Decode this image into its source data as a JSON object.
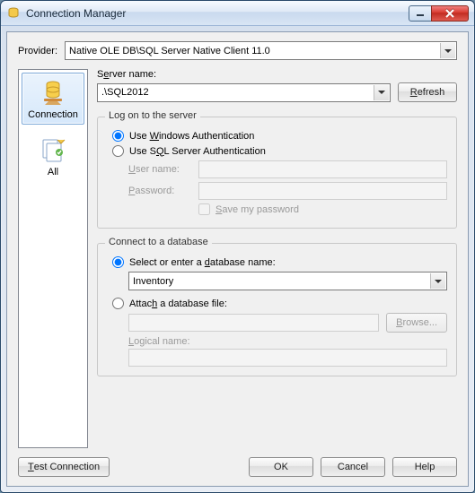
{
  "window": {
    "title": "Connection Manager"
  },
  "provider": {
    "label": "Provider:",
    "value": "Native OLE DB\\SQL Server Native Client 11.0"
  },
  "sidebar": {
    "items": [
      {
        "label": "Connection"
      },
      {
        "label": "All"
      }
    ]
  },
  "server": {
    "name_label": "Server name:",
    "value": ".\\SQL2012",
    "refresh_label": "Refresh"
  },
  "logon": {
    "legend": "Log on to the server",
    "use_windows_label": "Use Windows Authentication",
    "use_sql_label": "Use SQL Server Authentication",
    "username_label": "User name:",
    "username_value": "",
    "password_label": "Password:",
    "password_value": "",
    "save_password_label": "Save my password",
    "auth_mode": "windows",
    "save_password_checked": false
  },
  "database": {
    "legend": "Connect to a database",
    "select_label": "Select or enter a database name:",
    "db_value": "Inventory",
    "attach_label": "Attach a database file:",
    "file_value": "",
    "browse_label": "Browse...",
    "logical_label": "Logical name:",
    "logical_value": "",
    "mode": "select"
  },
  "footer": {
    "test_label": "Test Connection",
    "ok_label": "OK",
    "cancel_label": "Cancel",
    "help_label": "Help"
  }
}
